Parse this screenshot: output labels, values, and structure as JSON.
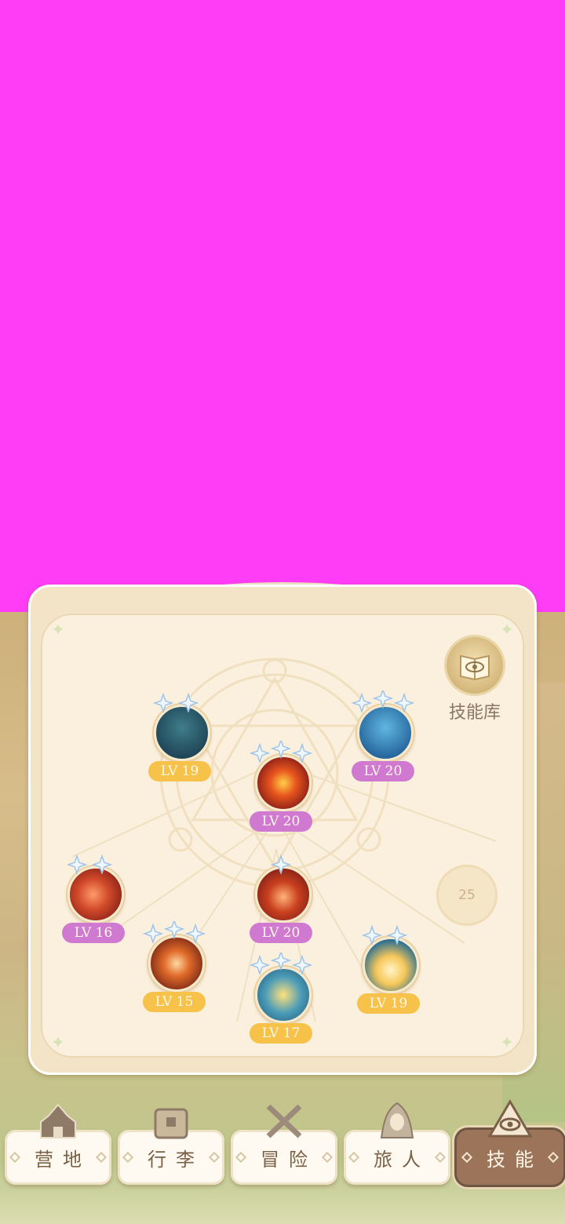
{
  "skill_library": {
    "label": "技能库",
    "icon": "eye-book-icon"
  },
  "skills": [
    {
      "id": "witch",
      "level": "LV 19",
      "stars": 2,
      "badge_color": "gold",
      "icon": "witch-broom-icon"
    },
    {
      "id": "ice-crown",
      "level": "LV 20",
      "stars": 3,
      "badge_color": "purple",
      "icon": "ice-spike-icon"
    },
    {
      "id": "fireball",
      "level": "LV 20",
      "stars": 3,
      "badge_color": "purple",
      "icon": "fireball-icon"
    },
    {
      "id": "fire-gem",
      "level": "LV 16",
      "stars": 2,
      "badge_color": "purple",
      "icon": "fire-gem-icon"
    },
    {
      "id": "meteor",
      "level": "LV 20",
      "stars": 1,
      "badge_color": "purple",
      "icon": "meteor-icon"
    },
    {
      "id": "fire-spiral",
      "level": "LV 15",
      "stars": 3,
      "badge_color": "gold",
      "icon": "fire-swirl-icon"
    },
    {
      "id": "wind-spiral",
      "level": "LV 17",
      "stars": 3,
      "badge_color": "gold",
      "icon": "wind-swirl-icon"
    },
    {
      "id": "golden-flame",
      "level": "LV 19",
      "stars": 2,
      "badge_color": "gold",
      "icon": "golden-flame-icon"
    }
  ],
  "locked_slot": {
    "number": "25"
  },
  "nav": {
    "items": [
      {
        "label": "营地",
        "icon": "camp-icon"
      },
      {
        "label": "行李",
        "icon": "chest-icon"
      },
      {
        "label": "冒险",
        "icon": "crossed-swords-icon"
      },
      {
        "label": "旅人",
        "icon": "hooded-traveler-icon"
      },
      {
        "label": "技能",
        "icon": "eye-emblem-icon",
        "active": true
      }
    ]
  },
  "colors": {
    "background_magenta": "#ff3cf6",
    "panel": "#fbf0dd",
    "badge_gold": "#f7c24a",
    "badge_purple": "#cf7ad0",
    "nav_active": "#9b7459"
  }
}
